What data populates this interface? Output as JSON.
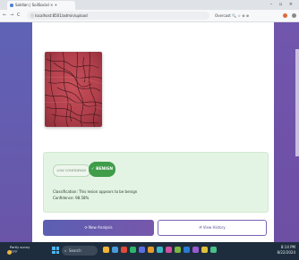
{
  "browser": {
    "tab_title": "Saldian | SoilSocial × +",
    "new_tab": "+",
    "window_controls": "–  ▫  ×",
    "nav_back": "←",
    "nav_forward": "→",
    "nav_reload": "C",
    "url": "ⓘ  localhost:8501/admin/upload",
    "extensions_label": "Overcast 🔍 ☆ ⊕ ⊕"
  },
  "result": {
    "chip_label": "LOW CONFIDENCE",
    "status_label": "✓ BENIGN",
    "classification_text": "Classification: This lesion appears to be benign",
    "confidence_text": "Confidence: 98.58%"
  },
  "actions": {
    "analyze_label": "⟳ New Analysis",
    "new_label": "🗎 View History"
  },
  "taskbar": {
    "weather_line1": "Partly sunny",
    "weather_line2": "73°F",
    "search_label": "Search",
    "tray_time": "8:14 PM",
    "tray_date": "8/22/2024"
  },
  "colors": {
    "accent_purple": "#6a55a8",
    "benign_green": "#3f9d4a",
    "result_bg": "#e4f4e4"
  },
  "icons": [
    "browser-favicon",
    "back-icon",
    "forward-icon",
    "reload-icon",
    "info-icon",
    "weather-icon",
    "windows-start-icon",
    "search-icon"
  ]
}
